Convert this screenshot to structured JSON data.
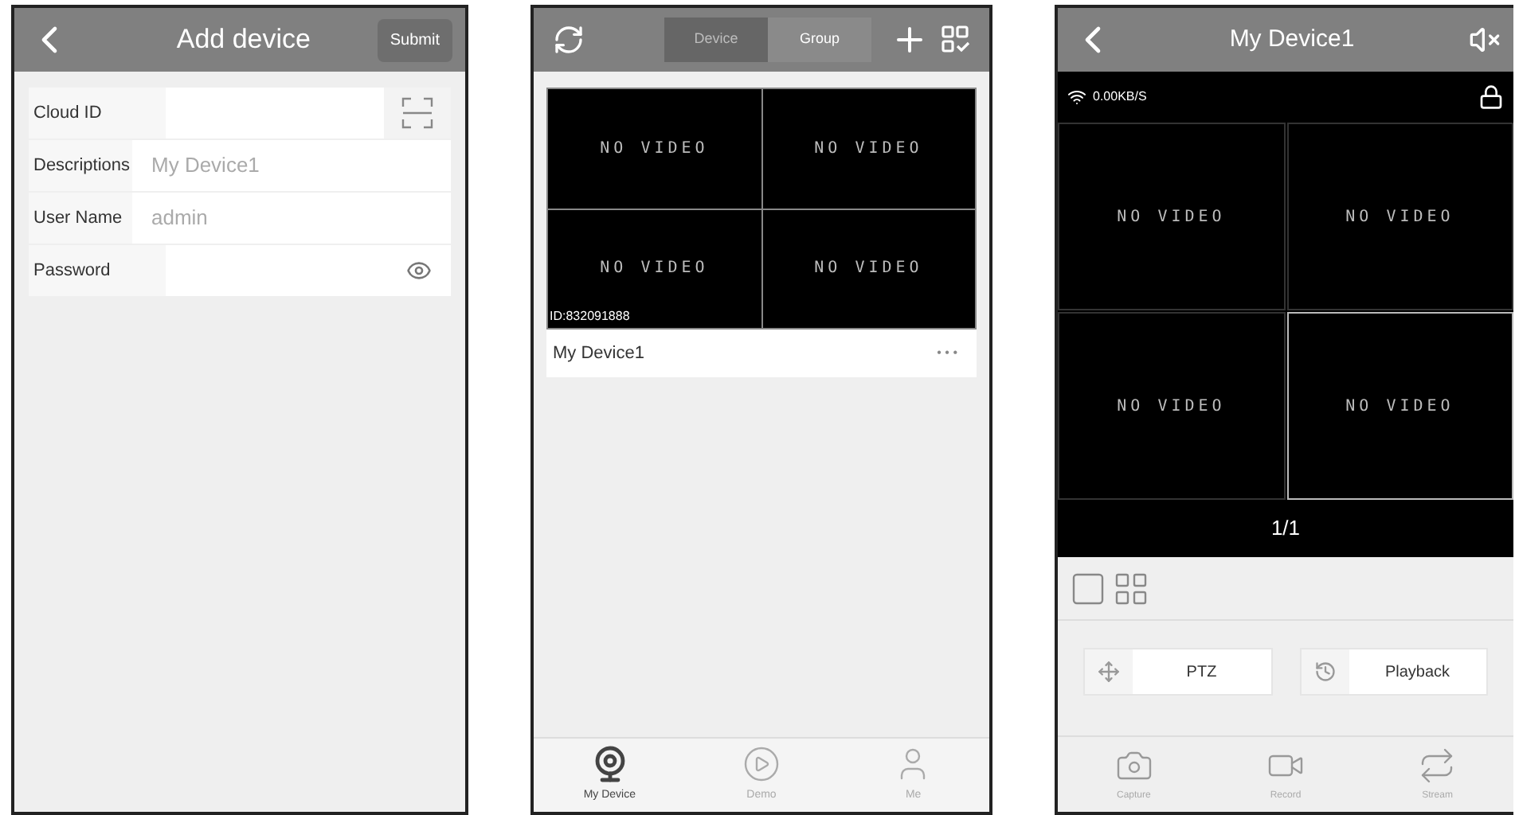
{
  "add_device": {
    "title": "Add device",
    "submit": "Submit",
    "fields": [
      {
        "label": "Cloud ID",
        "kind": "scan"
      },
      {
        "label": "Descriptions",
        "placeholder": "My Device1",
        "kind": "text"
      },
      {
        "label": "User Name",
        "placeholder": "admin",
        "kind": "text"
      },
      {
        "label": "Password",
        "kind": "password"
      }
    ]
  },
  "device_list": {
    "segments": [
      {
        "label": "Device",
        "selected": true
      },
      {
        "label": "Group",
        "selected": false
      }
    ],
    "device": {
      "tiles": [
        "NO VIDEO",
        "NO VIDEO",
        "NO VIDEO",
        "NO VIDEO"
      ],
      "id": "ID:832091888",
      "name": "My Device1",
      "more": "• • •"
    },
    "nav": [
      {
        "label": "My Device",
        "kind": "camera",
        "selected": true
      },
      {
        "label": "Demo",
        "kind": "play",
        "selected": false
      },
      {
        "label": "Me",
        "kind": "user",
        "selected": false
      }
    ]
  },
  "live_view": {
    "title": "My Device1",
    "speed": "0.00KB/S",
    "tiles": [
      {
        "text": "NO VIDEO",
        "selected": false
      },
      {
        "text": "NO VIDEO",
        "selected": false
      },
      {
        "text": "NO VIDEO",
        "selected": false
      },
      {
        "text": "NO VIDEO",
        "selected": true
      }
    ],
    "page": "1/1",
    "actions": [
      {
        "label": "PTZ",
        "kind": "ptz"
      },
      {
        "label": "Playback",
        "kind": "playback"
      }
    ],
    "nav": [
      {
        "label": "Capture",
        "kind": "capture"
      },
      {
        "label": "Record",
        "kind": "record"
      },
      {
        "label": "Stream",
        "kind": "stream"
      }
    ]
  }
}
